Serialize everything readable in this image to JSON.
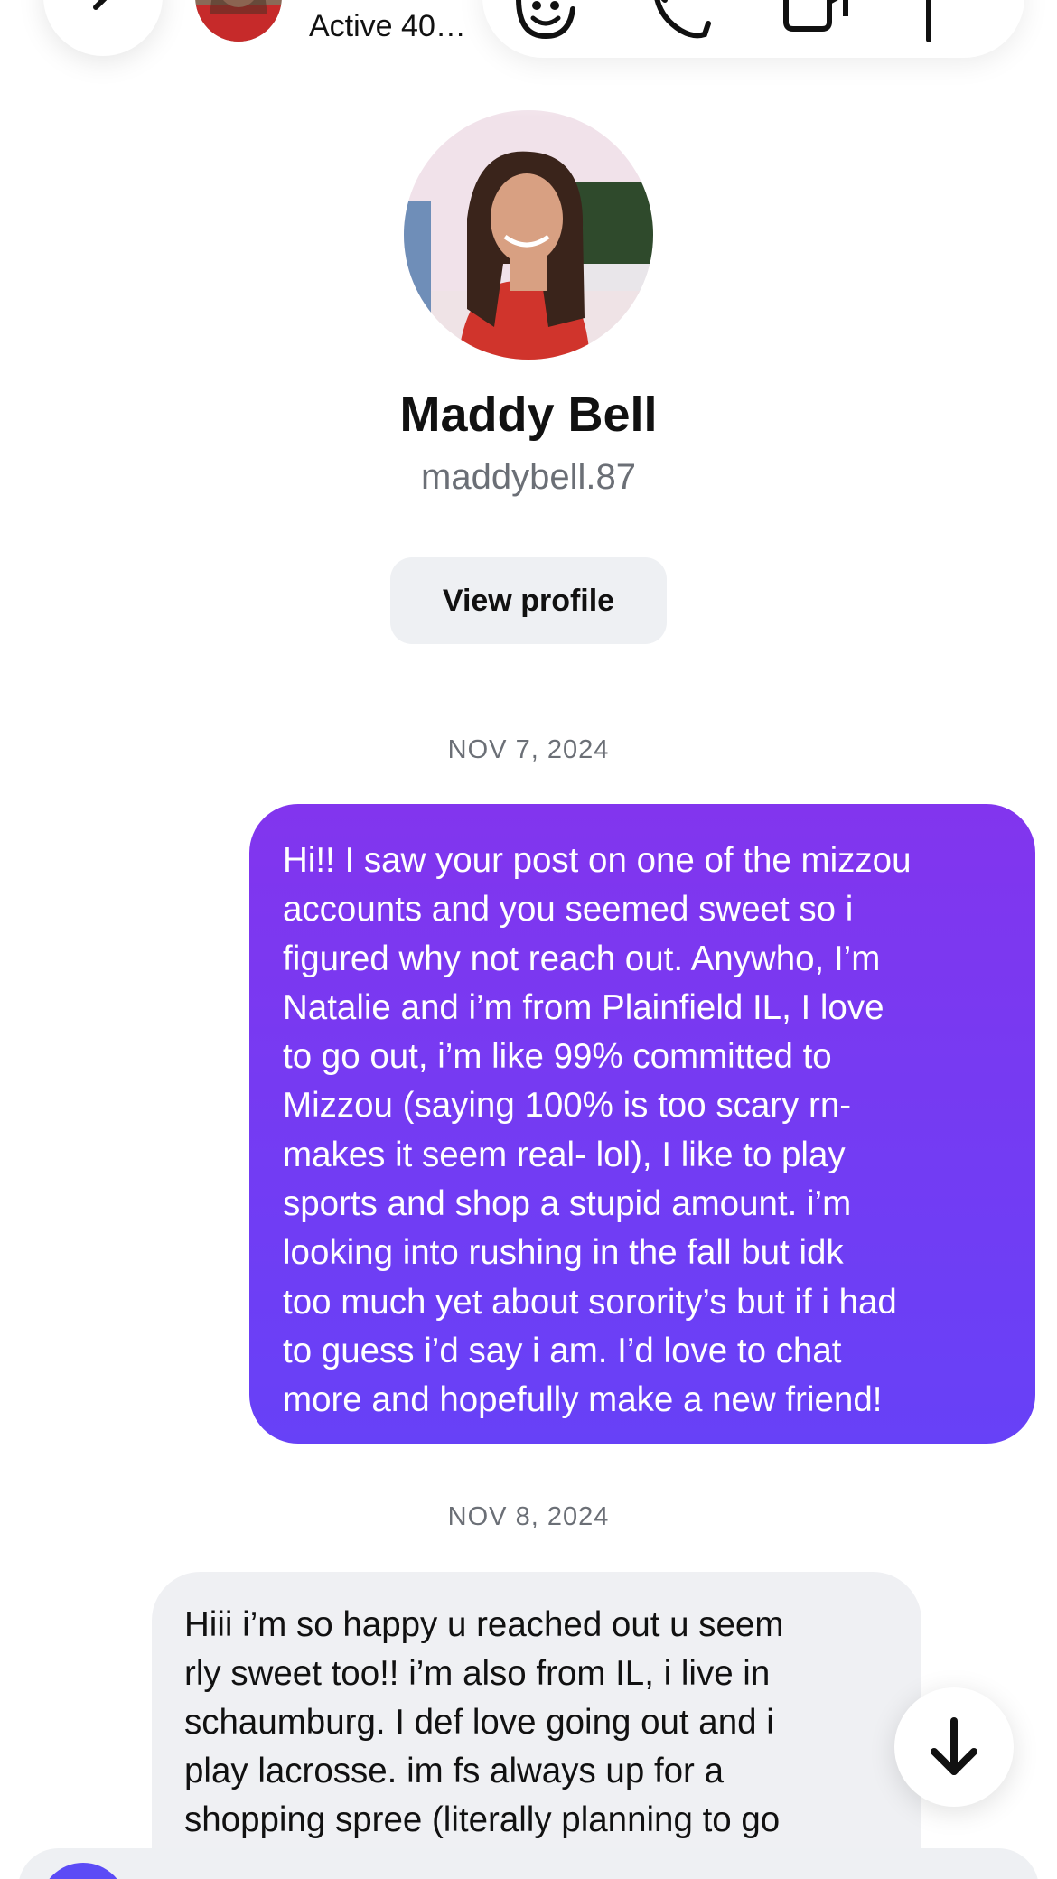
{
  "header": {
    "status_text": "Active 40…",
    "icons": [
      "back-chevron-icon",
      "sticker-face-icon",
      "phone-icon",
      "video-camera-icon",
      "flag-icon"
    ]
  },
  "profile": {
    "name": "Maddy Bell",
    "handle": "maddybell.87",
    "view_profile_label": "View profile"
  },
  "conversation": {
    "date_1": "NOV 7, 2024",
    "outgoing_message_lines": [
      "Hi!! I saw your post on one of the mizzou",
      "accounts and you seemed sweet so i",
      "figured why not reach out. Anywho, I’m",
      "Natalie and i’m from Plainfield IL, I love",
      "to go out, i’m like 99% committed to",
      "Mizzou (saying 100% is too scary rn-",
      "makes it seem real- lol), I like to play",
      "sports and shop a stupid amount.  i’m",
      "looking into rushing in the fall but idk",
      "too much yet about sorority’s but if i had",
      "to guess i’d say i am. I’d love to chat",
      "more and hopefully make a new friend!"
    ],
    "date_2": "NOV 8, 2024",
    "incoming_message_lines": [
      "Hiii i’m so happy u reached out u seem",
      "rly sweet too!! i’m also from IL, i live in",
      "schaumburg. I def love going out and i",
      "play lacrosse. im fs always up for a",
      "shopping spree (literally planning to go"
    ]
  },
  "colors": {
    "outgoing_bubble_top": "#8235ee",
    "outgoing_bubble_bottom": "#6741f7",
    "incoming_bubble": "#eff0f3",
    "accent": "#5b4bf6"
  }
}
